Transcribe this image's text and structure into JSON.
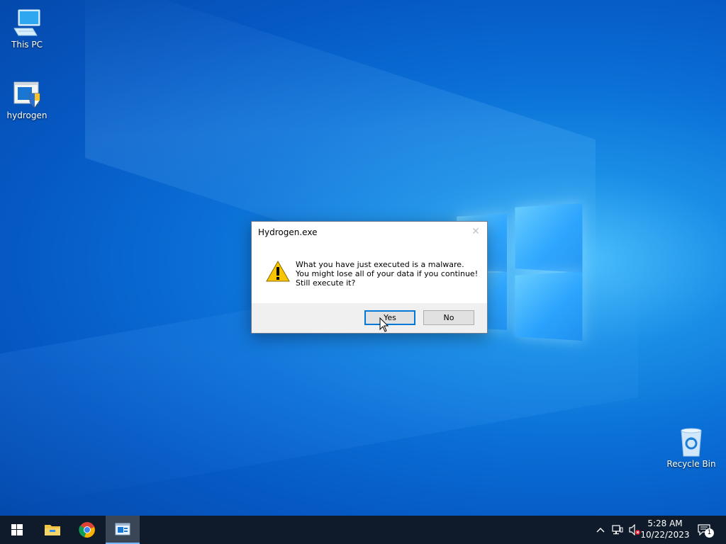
{
  "desktop": {
    "icons": [
      {
        "label": "This PC",
        "icon": "computer-icon"
      },
      {
        "label": "hydrogen",
        "icon": "shield-installer-icon"
      },
      {
        "label": "Recycle Bin",
        "icon": "recycle-bin-icon"
      }
    ]
  },
  "dialog": {
    "title": "Hydrogen.exe",
    "close_glyph": "✕",
    "message_lines": [
      "What you have just executed is a malware.",
      "You might lose all of your data if you continue!",
      "Still execute it?"
    ],
    "icon": "warning-icon",
    "buttons": {
      "yes": "Yes",
      "no": "No"
    }
  },
  "taskbar": {
    "apps": [
      {
        "name": "start-button",
        "icon": "windows-logo-icon"
      },
      {
        "name": "file-explorer",
        "icon": "folder-icon"
      },
      {
        "name": "chrome",
        "icon": "chrome-icon"
      },
      {
        "name": "hydrogen-app",
        "icon": "app-window-icon",
        "active": true
      }
    ],
    "tray": {
      "icons": [
        "chevron-up-icon",
        "network-icon",
        "volume-muted-icon"
      ],
      "time": "5:28 AM",
      "date": "10/22/2023",
      "notification_count": "1"
    }
  },
  "colors": {
    "accent": "#0078d7",
    "taskbar": "#0f1b2b",
    "desktop": "#0a6fd6"
  }
}
